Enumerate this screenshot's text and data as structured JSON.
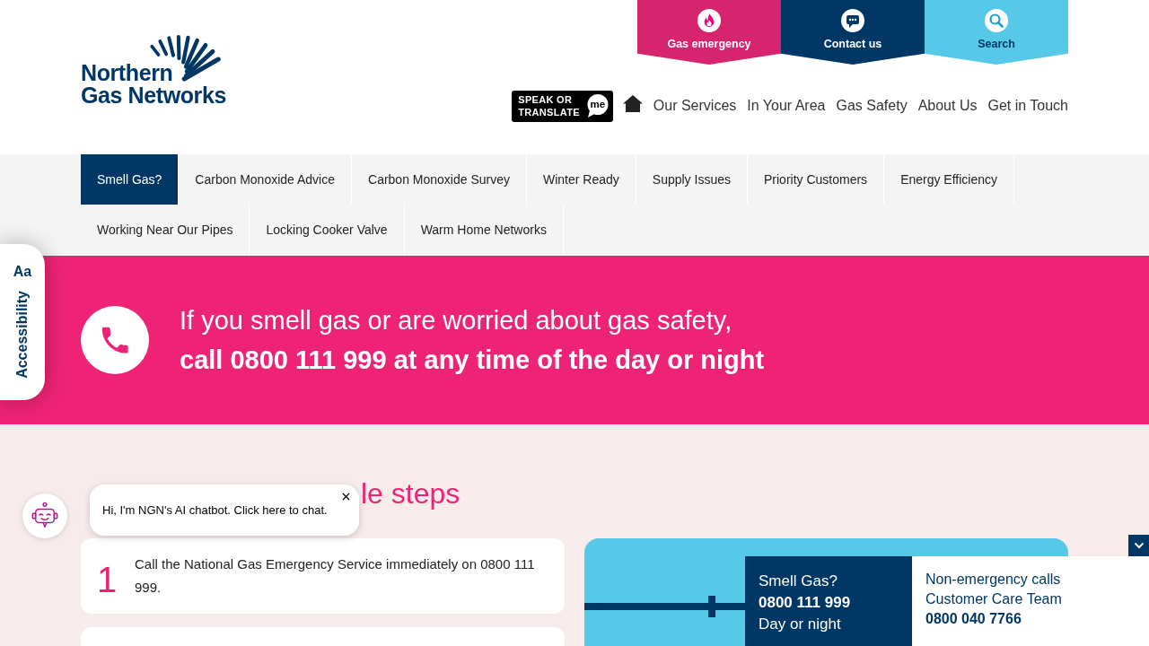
{
  "logo": {
    "line_1": "Northern",
    "line_2": "Gas Networks"
  },
  "quick_links": [
    {
      "kind": "emergency",
      "label": "Gas emergency"
    },
    {
      "kind": "contact",
      "label": "Contact us"
    },
    {
      "kind": "search",
      "label": "Search"
    }
  ],
  "translate_button": {
    "line_1": "SPEAK OR",
    "line_2": "TRANSLATE",
    "bubble": "me"
  },
  "main_nav": [
    "Our Services",
    "In Your Area",
    "Gas Safety",
    "About Us",
    "Get in Touch"
  ],
  "section_menu": [
    {
      "label": "Smell Gas?",
      "selected": true
    },
    {
      "label": "Carbon Monoxide Advice",
      "selected": false
    },
    {
      "label": "Carbon Monoxide Survey",
      "selected": false
    },
    {
      "label": "Winter Ready",
      "selected": false
    },
    {
      "label": "Supply Issues",
      "selected": false
    },
    {
      "label": "Priority Customers",
      "selected": false
    },
    {
      "label": "Energy Efficiency",
      "selected": false
    },
    {
      "label": "Working Near Our Pipes",
      "selected": false
    },
    {
      "label": "Locking Cooker Valve",
      "selected": false
    },
    {
      "label": "Warm Home Networks",
      "selected": false
    }
  ],
  "accessibility_tab": {
    "badge": "Aa",
    "label": "Accessibility"
  },
  "emergency_banner": {
    "text": "If you smell gas or are worried about gas safety,\n**call 0800 111 999 at any time of the day or night**"
  },
  "steps_heading": "le steps",
  "steps": [
    {
      "number": "1",
      "text": "Call the National Gas Emergency Service immediately on 0800 111 999."
    }
  ],
  "contact_panel": {
    "emergency": {
      "title": "Smell Gas?",
      "phone": "0800 111 999",
      "note": "Day or night"
    },
    "non_emergency": {
      "title": "Non-emergency calls",
      "team": "Customer Care Team",
      "phone": "0800 040 7766"
    }
  },
  "chatbot": {
    "message": "Hi, I'm NGN's AI chatbot. Click here to chat."
  }
}
